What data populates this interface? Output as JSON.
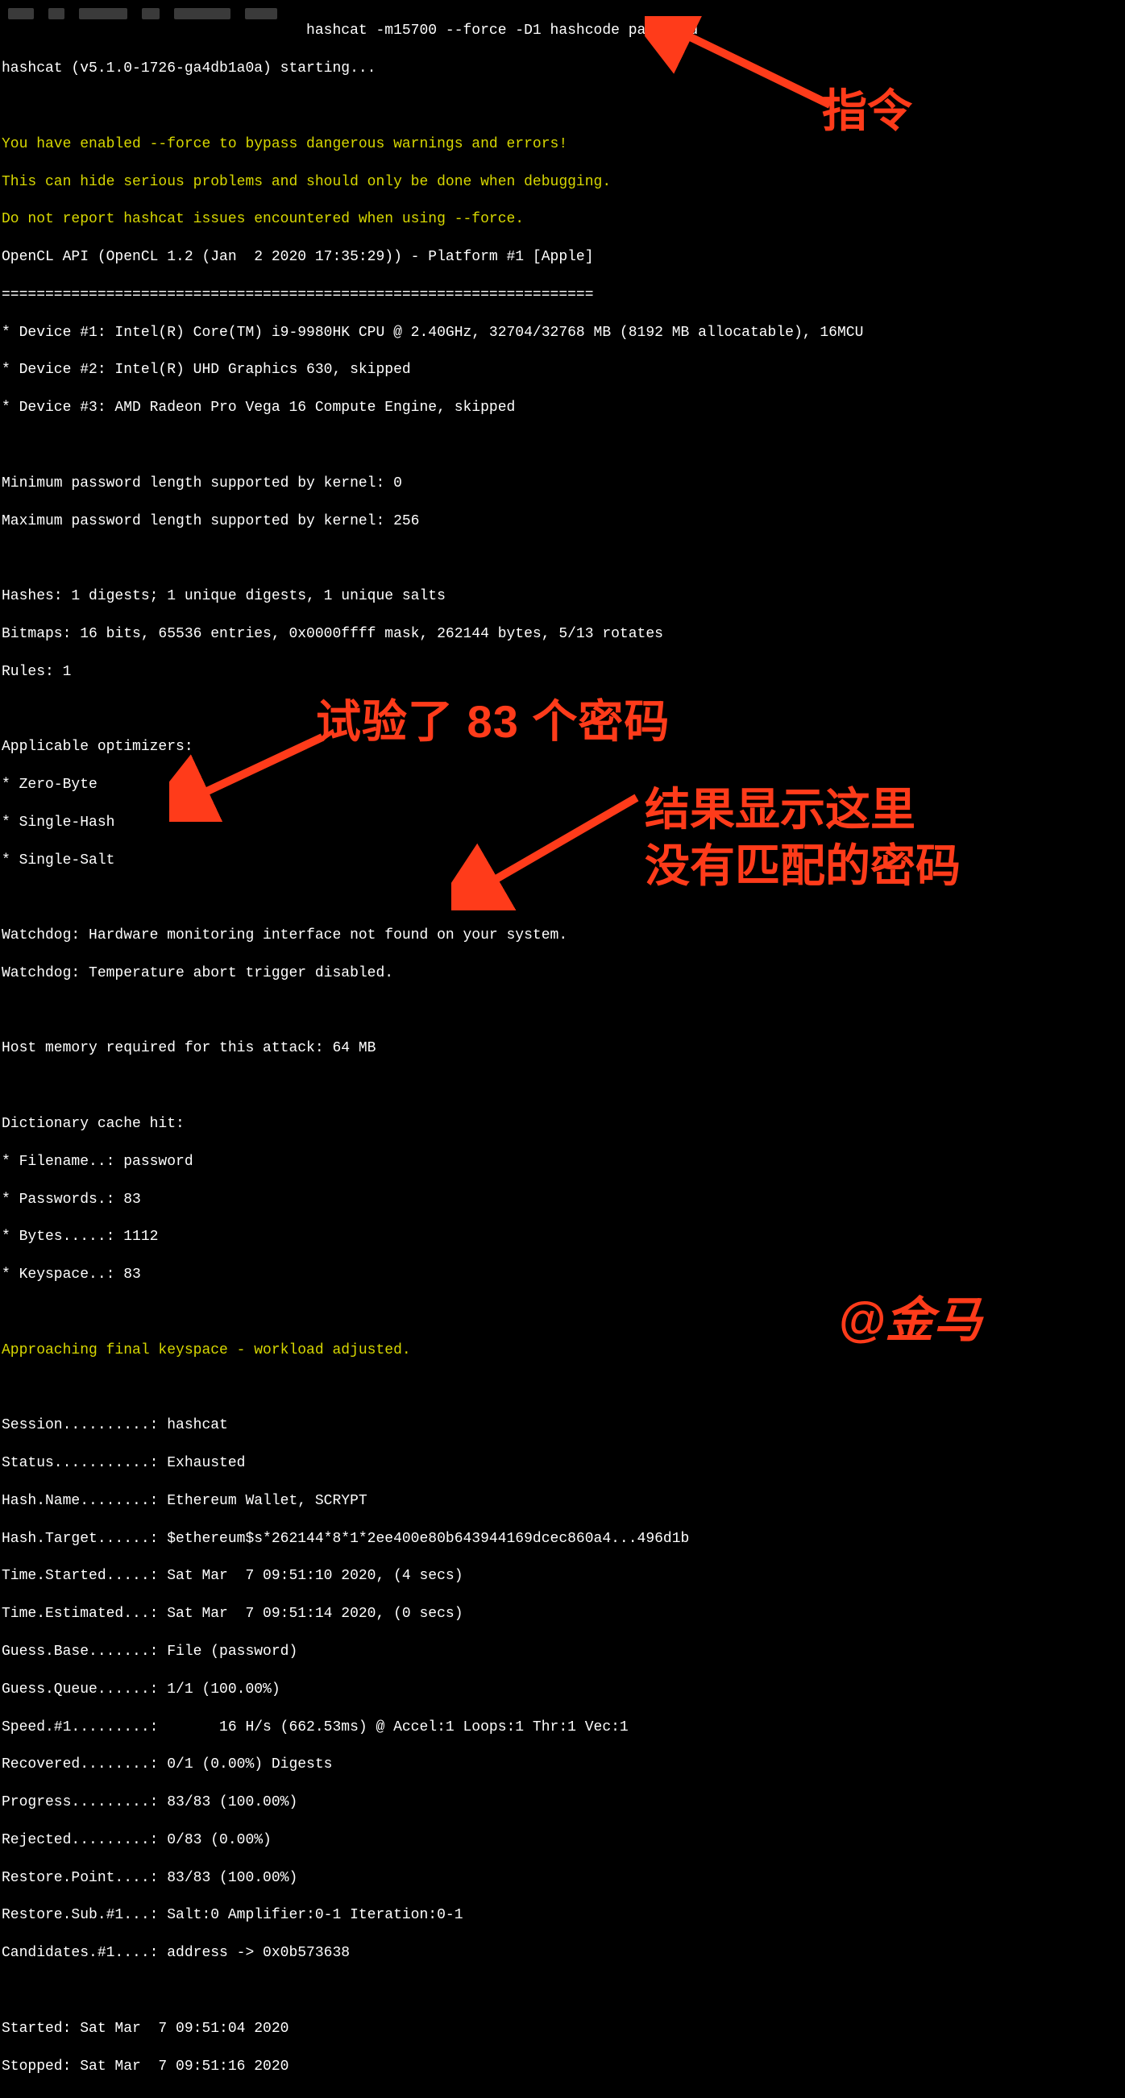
{
  "prompt_cmd": "                                   hashcat -m15700 --force -D1 hashcode password",
  "starting": "hashcat (v5.1.0-1726-ga4db1a0a) starting...",
  "warn1": "You have enabled --force to bypass dangerous warnings and errors!",
  "warn2": "This can hide serious problems and should only be done when debugging.",
  "warn3": "Do not report hashcat issues encountered when using --force.",
  "opencl": "OpenCL API (OpenCL 1.2 (Jan  2 2020 17:35:29)) - Platform #1 [Apple]",
  "rule": "====================================================================",
  "dev1": "* Device #1: Intel(R) Core(TM) i9-9980HK CPU @ 2.40GHz, 32704/32768 MB (8192 MB allocatable), 16MCU",
  "dev2": "* Device #2: Intel(R) UHD Graphics 630, skipped",
  "dev3": "* Device #3: AMD Radeon Pro Vega 16 Compute Engine, skipped",
  "minpwd": "Minimum password length supported by kernel: 0",
  "maxpwd": "Maximum password length supported by kernel: 256",
  "hashes": "Hashes: 1 digests; 1 unique digests, 1 unique salts",
  "bitmaps": "Bitmaps: 16 bits, 65536 entries, 0x0000ffff mask, 262144 bytes, 5/13 rotates",
  "rules": "Rules: 1",
  "opts_hdr": "Applicable optimizers:",
  "opt1": "* Zero-Byte",
  "opt2": "* Single-Hash",
  "opt3": "* Single-Salt",
  "wd1": "Watchdog: Hardware monitoring interface not found on your system.",
  "wd2": "Watchdog: Temperature abort trigger disabled.",
  "hostmem": "Host memory required for this attack: 64 MB",
  "dict_hdr": "Dictionary cache hit:",
  "dict_fn": "* Filename..: password",
  "dict_pw": "* Passwords.: 83",
  "dict_by": "* Bytes.....: 1112",
  "dict_ks": "* Keyspace..: 83",
  "approach": "Approaching final keyspace - workload adjusted.",
  "s_session": "Session..........: hashcat",
  "s_status": "Status...........: Exhausted",
  "s_hashname": "Hash.Name........: Ethereum Wallet, SCRYPT",
  "s_hashtgt": "Hash.Target......: $ethereum$s*262144*8*1*2ee400e80b643944169dcec860a4...496d1b",
  "s_tstart": "Time.Started.....: Sat Mar  7 09:51:10 2020, (4 secs)",
  "s_test": "Time.Estimated...: Sat Mar  7 09:51:14 2020, (0 secs)",
  "s_gbase": "Guess.Base.......: File (password)",
  "s_gqueue": "Guess.Queue......: 1/1 (100.00%)",
  "s_speed": "Speed.#1.........:       16 H/s (662.53ms) @ Accel:1 Loops:1 Thr:1 Vec:1",
  "s_rec": "Recovered........: 0/1 (0.00%) Digests",
  "s_prog": "Progress.........: 83/83 (100.00%)",
  "s_rej": "Rejected.........: 0/83 (0.00%)",
  "s_rpoint": "Restore.Point....: 83/83 (100.00%)",
  "s_rsub": "Restore.Sub.#1...: Salt:0 Amplifier:0-1 Iteration:0-1",
  "s_cand": "Candidates.#1....: address -> 0x0b573638",
  "started": "Started: Sat Mar  7 09:51:04 2020",
  "stopped": "Stopped: Sat Mar  7 09:51:16 2020",
  "annot": {
    "cmd": "指令",
    "tried": "试验了 83 个密码",
    "result_l1": "结果显示这里",
    "result_l2": "没有匹配的密码",
    "sig": "@金马"
  }
}
